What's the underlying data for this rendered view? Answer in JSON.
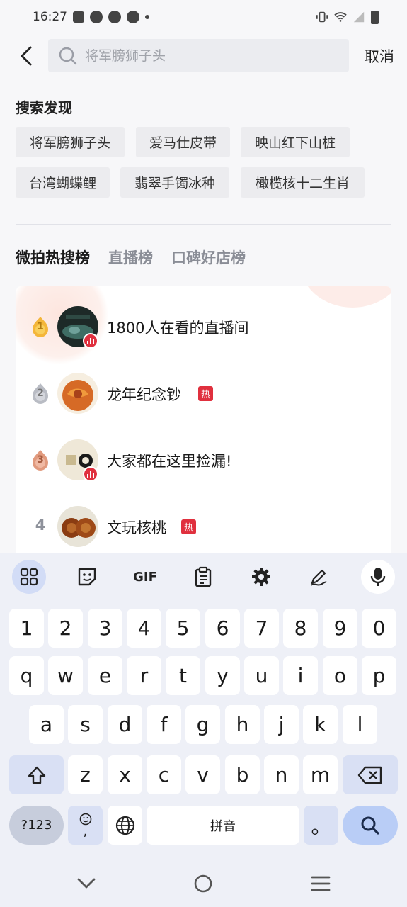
{
  "status_bar": {
    "time": "16:27"
  },
  "search": {
    "placeholder": "将军膀狮子头",
    "cancel_label": "取消"
  },
  "discover": {
    "title": "搜索发现",
    "chips": [
      "将军膀狮子头",
      "爱马仕皮带",
      "映山红下山桩",
      "台湾蝴蝶鲤",
      "翡翠手镯冰种",
      "橄榄核十二生肖"
    ]
  },
  "tabs": [
    {
      "label": "微拍热搜榜",
      "active": true
    },
    {
      "label": "直播榜",
      "active": false
    },
    {
      "label": "口碑好店榜",
      "active": false
    }
  ],
  "ranking": [
    {
      "rank": "1",
      "title": "1800人在看的直播间",
      "live": true,
      "hot": false
    },
    {
      "rank": "2",
      "title": "龙年纪念钞",
      "live": false,
      "hot": true
    },
    {
      "rank": "3",
      "title": "大家都在这里捡漏!",
      "live": true,
      "hot": false
    },
    {
      "rank": "4",
      "title": "文玩核桃",
      "live": false,
      "hot": true
    }
  ],
  "hot_label": "热",
  "keyboard": {
    "toolbar_gif": "GIF",
    "row_numbers": [
      "1",
      "2",
      "3",
      "4",
      "5",
      "6",
      "7",
      "8",
      "9",
      "0"
    ],
    "row_1": [
      "q",
      "w",
      "e",
      "r",
      "t",
      "y",
      "u",
      "i",
      "o",
      "p"
    ],
    "row_2": [
      "a",
      "s",
      "d",
      "f",
      "g",
      "h",
      "j",
      "k",
      "l"
    ],
    "row_3": [
      "z",
      "x",
      "c",
      "v",
      "b",
      "n",
      "m"
    ],
    "symbols_label": "?123",
    "emoji_comma": ",",
    "space_label": "拼音",
    "period_label": "。"
  },
  "colors": {
    "hot_red": "#e0303e",
    "keyboard_bg": "#eef0f7",
    "action_key": "#b9cdf6"
  }
}
